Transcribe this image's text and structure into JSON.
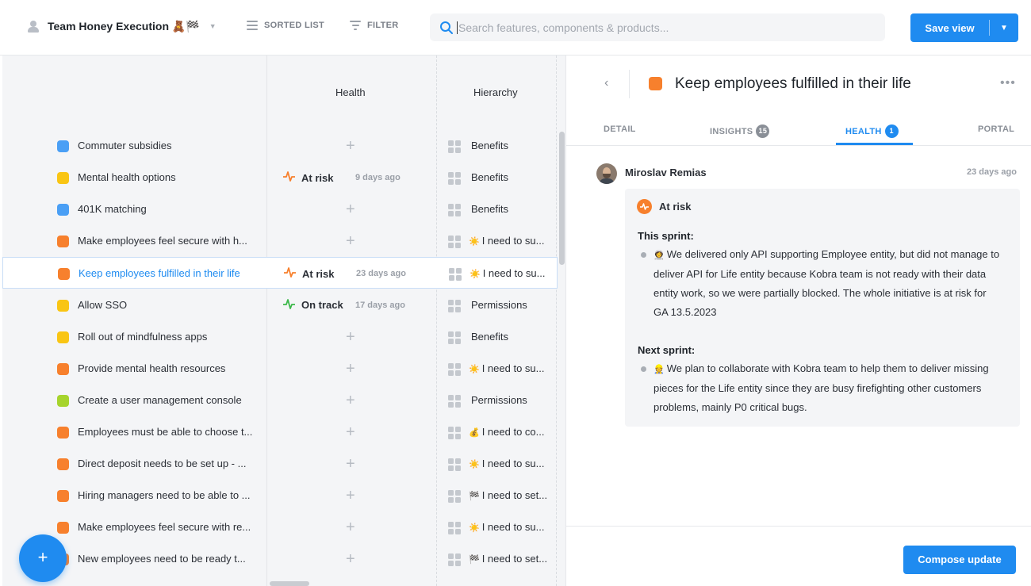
{
  "header": {
    "view_title": "Team Honey Execution",
    "view_emoji": "🧸🏁",
    "sorted_list_label": "SORTED LIST",
    "filter_label": "FILTER",
    "search_placeholder": "Search features, components & products...",
    "save_view_label": "Save view",
    "accent_color": "#1f8bf0"
  },
  "table": {
    "columns": {
      "health": "Health",
      "hierarchy": "Hierarchy"
    },
    "rows": [
      {
        "name": "Commuter subsidies",
        "color": "#4a9ff5",
        "health": null,
        "hier_emoji": "",
        "hierarchy": "Benefits"
      },
      {
        "name": "Mental health options",
        "color": "#f9c514",
        "health": {
          "label": "At risk",
          "ago": "9 days ago",
          "kind": "at-risk"
        },
        "hier_emoji": "",
        "hierarchy": "Benefits"
      },
      {
        "name": "401K matching",
        "color": "#4a9ff5",
        "health": null,
        "hier_emoji": "",
        "hierarchy": "Benefits"
      },
      {
        "name": "Make employees feel secure with h...",
        "color": "#f7802d",
        "health": null,
        "hier_emoji": "☀️",
        "hierarchy": "I need to su..."
      },
      {
        "name": "Keep employees fulfilled in their life",
        "color": "#f7802d",
        "health": {
          "label": "At risk",
          "ago": "23 days ago",
          "kind": "at-risk"
        },
        "hier_emoji": "☀️",
        "hierarchy": "I need to su...",
        "selected": true
      },
      {
        "name": "Allow SSO",
        "color": "#f9c514",
        "health": {
          "label": "On track",
          "ago": "17 days ago",
          "kind": "on-track"
        },
        "hier_emoji": "",
        "hierarchy": "Permissions"
      },
      {
        "name": "Roll out of mindfulness apps",
        "color": "#f9c514",
        "health": null,
        "hier_emoji": "",
        "hierarchy": "Benefits"
      },
      {
        "name": "Provide mental health resources",
        "color": "#f7802d",
        "health": null,
        "hier_emoji": "☀️",
        "hierarchy": "I need to su..."
      },
      {
        "name": "Create a user management console",
        "color": "#a6d42d",
        "health": null,
        "hier_emoji": "",
        "hierarchy": "Permissions"
      },
      {
        "name": "Employees must be able to choose t...",
        "color": "#f7802d",
        "health": null,
        "hier_emoji": "💰",
        "hierarchy": "I need to co..."
      },
      {
        "name": "Direct deposit needs to be set up - ...",
        "color": "#f7802d",
        "health": null,
        "hier_emoji": "☀️",
        "hierarchy": "I need to su..."
      },
      {
        "name": "Hiring managers need to be able to ...",
        "color": "#f7802d",
        "health": null,
        "hier_emoji": "🏁",
        "hierarchy": "I need to set..."
      },
      {
        "name": "Make employees feel secure with re...",
        "color": "#f7802d",
        "health": null,
        "hier_emoji": "☀️",
        "hierarchy": "I need to su..."
      },
      {
        "name": "New employees need to be ready t...",
        "color": "#f7802d",
        "health": null,
        "hier_emoji": "🏁",
        "hierarchy": "I need to set..."
      }
    ],
    "add_glyph": "+"
  },
  "fab_label": "+",
  "detail": {
    "title": "Keep employees fulfilled in their life",
    "color": "#f7802d",
    "tabs": {
      "detail": "DETAIL",
      "insights": "INSIGHTS",
      "insights_count": "15",
      "health": "HEALTH",
      "health_count": "1",
      "portal": "PORTAL"
    },
    "update": {
      "author": "Miroslav Remias",
      "date": "23 days ago",
      "status": "At risk",
      "this_sprint_label": "This sprint:",
      "this_sprint_emoji": "👩‍🚀",
      "this_sprint_text": "We delivered only API supporting Employee entity, but did not manage to deliver API for Life entity because Kobra team is not ready with their data entity work, so we were partially blocked. The whole initiative is at risk for GA 13.5.2023",
      "next_sprint_label": "Next sprint:",
      "next_sprint_emoji": "👷",
      "next_sprint_text": "We plan to collaborate with Kobra team to help them to deliver missing pieces for the Life entity since they are busy firefighting other customers problems, mainly P0 critical bugs."
    },
    "compose_label": "Compose update"
  }
}
